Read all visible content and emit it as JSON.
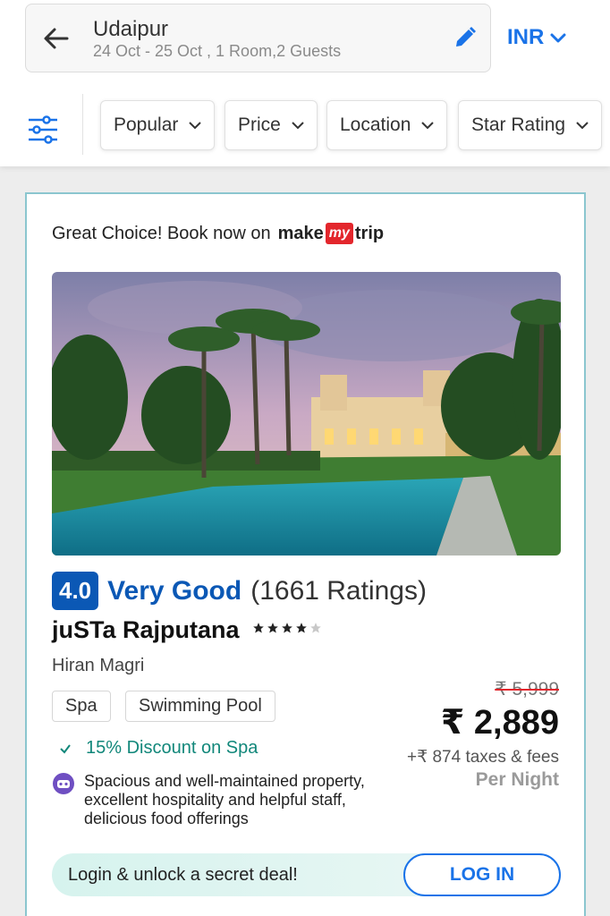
{
  "header": {
    "city": "Udaipur",
    "dates_guests": "24 Oct - 25 Oct , 1 Room,2 Guests",
    "currency": "INR"
  },
  "filters": [
    {
      "label": "Popular"
    },
    {
      "label": "Price"
    },
    {
      "label": "Location"
    },
    {
      "label": "Star Rating"
    }
  ],
  "card": {
    "promo_text": "Great Choice! Book now on",
    "brand_make": "make",
    "brand_my": "my",
    "brand_trip": "trip",
    "rating_value": "4.0",
    "rating_label": "Very Good",
    "rating_count": "(1661 Ratings)",
    "hotel_name": "juSTa Rajputana",
    "star_rating": 4,
    "star_max": 5,
    "locality": "Hiran Magri",
    "tags": [
      "Spa",
      "Swimming Pool"
    ],
    "discount": "15% Discount on Spa",
    "review": "Spacious and well-maintained property, excellent hospitality and helpful staff, delicious food offerings",
    "old_price": "₹ 5,999",
    "price": "₹ 2,889",
    "taxes": "+₹ 874 taxes & fees",
    "per_night": "Per Night",
    "login_text": "Login & unlock a secret deal!",
    "login_button": "LOG IN"
  },
  "colors": {
    "accent_blue": "#1a73e8",
    "rating_blue": "#0b58b5",
    "discount_green": "#11877a",
    "brand_red": "#e3262c"
  }
}
